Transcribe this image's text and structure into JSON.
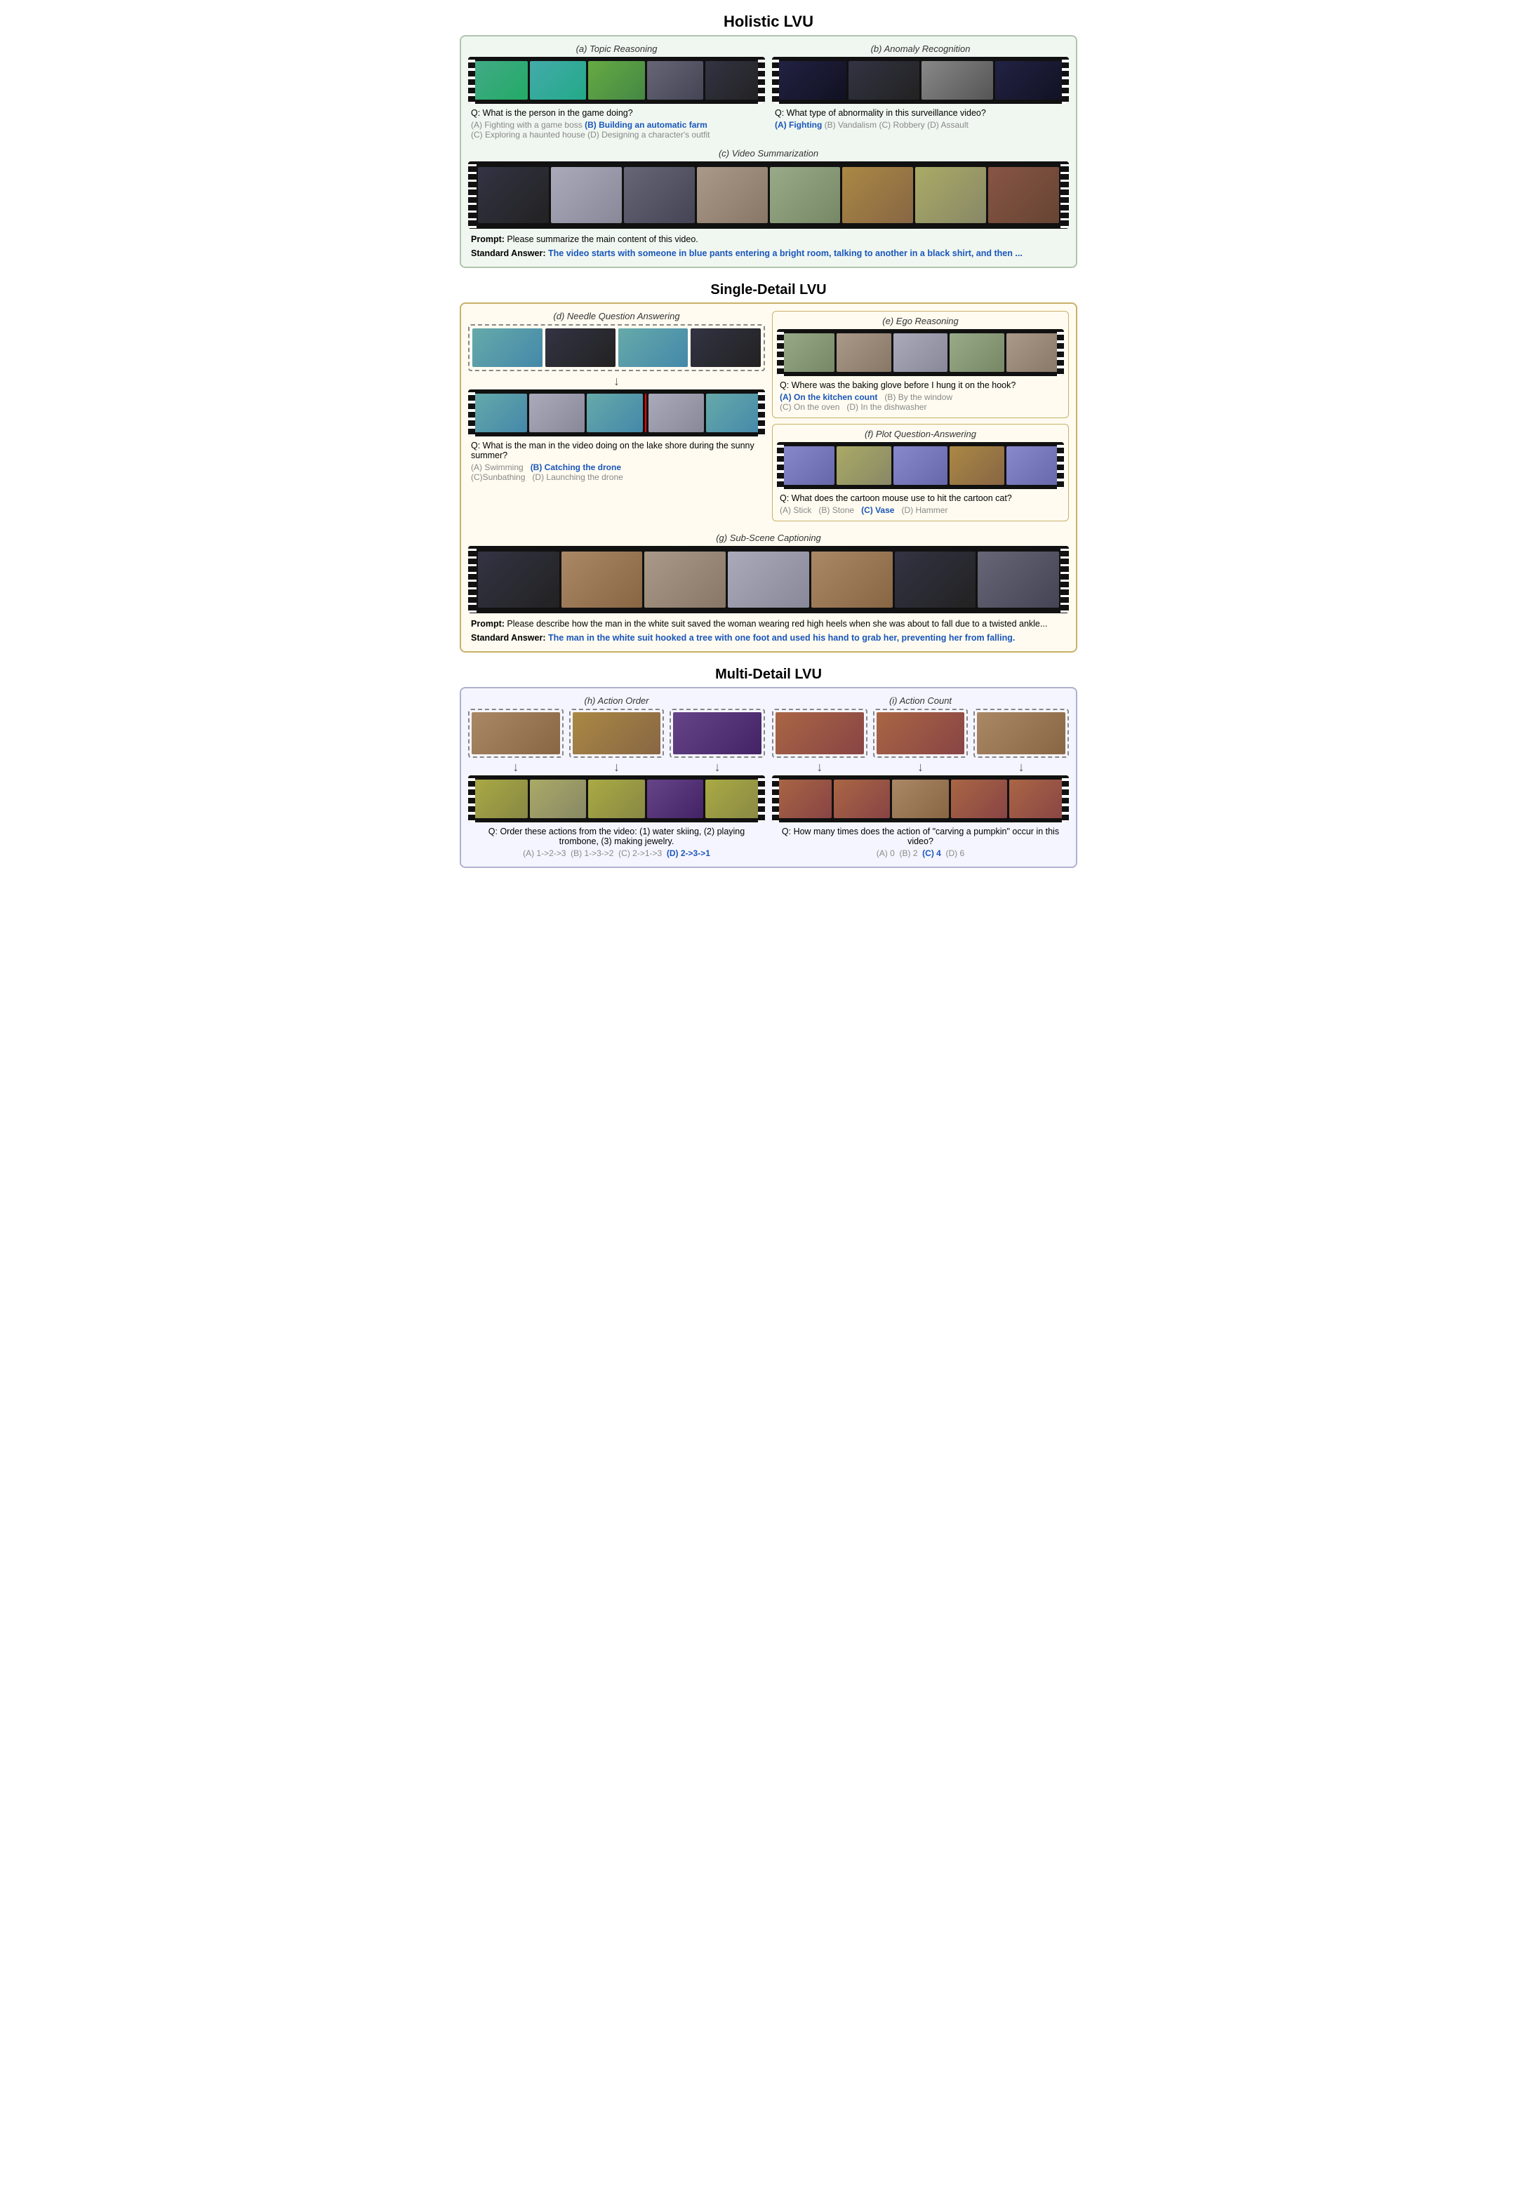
{
  "page": {
    "title": "Holistic LVU",
    "section_single": "Single-Detail LVU",
    "section_multi": "Multi-Detail LVU"
  },
  "holistic": {
    "topic_reasoning": {
      "title": "(a) Topic Reasoning",
      "question": "Q: What is the person in the game doing?",
      "options_wrong1": "(A) Fighting with a game boss",
      "answer": "(B) Building an automatic farm",
      "options_wrong2": "(C) Exploring a haunted house (D) Designing a character's outfit"
    },
    "anomaly_recognition": {
      "title": "(b) Anomaly Recognition",
      "question": "Q: What type of abnormality in this surveillance video?",
      "answer": "(A) Fighting",
      "options_wrong": "(B) Vandalism  (C) Robbery  (D) Assault"
    },
    "video_summarization": {
      "title": "(c) Video Summarization",
      "prompt_label": "Prompt:",
      "prompt_text": "Please summarize the main content of this video.",
      "answer_label": "Standard Answer:",
      "answer_text": "The video starts with someone in blue pants entering a bright room, talking to another in a black shirt, and then ..."
    }
  },
  "single_detail": {
    "needle_qa": {
      "title": "(d) Needle Question Answering",
      "question": "Q: What is the man in the video doing on the lake shore during the sunny summer?",
      "option_a": "(A) Swimming",
      "answer": "(B) Catching the drone",
      "option_c": "(C)Sunbathing",
      "option_d": "(D) Launching the drone"
    },
    "ego_reasoning": {
      "title": "(e) Ego Reasoning",
      "question": "Q: Where was the baking glove before I hung it on the hook?",
      "answer": "(A) On the kitchen count",
      "option_b": "(B) By the window",
      "option_c": "(C) On the oven",
      "option_d": "(D) In the dishwasher"
    },
    "plot_qa": {
      "title": "(f) Plot Question-Answering",
      "question": "Q: What does the cartoon mouse use to hit the cartoon cat?",
      "option_a": "(A) Stick",
      "option_b": "(B) Stone",
      "answer": "(C) Vase",
      "option_d": "(D) Hammer"
    },
    "sub_scene": {
      "title": "(g) Sub-Scene Captioning",
      "prompt_label": "Prompt:",
      "prompt_text": "Please describe how the man in the white suit saved the woman wearing red high heels when she was about to fall due to a twisted ankle...",
      "answer_label": "Standard Answer:",
      "answer_text": "The man in the white suit hooked a tree with one foot and used his hand to grab her, preventing her from falling."
    }
  },
  "multi_detail": {
    "action_order": {
      "title": "(h) Action Order",
      "question": "Q: Order these actions from the video: (1) water skiing, (2) playing trombone, (3) making jewelry.",
      "option_a": "(A) 1->2->3",
      "option_b": "(B) 1->3->2",
      "option_c": "(C) 2->1->3",
      "answer": "(D) 2->3->1"
    },
    "action_count": {
      "title": "(i) Action Count",
      "question": "Q: How many times does the action of \"carving a pumpkin\" occur in this video?",
      "option_a": "(A) 0",
      "option_b": "(B) 2",
      "answer": "(C) 4",
      "option_d": "(D) 6"
    }
  }
}
